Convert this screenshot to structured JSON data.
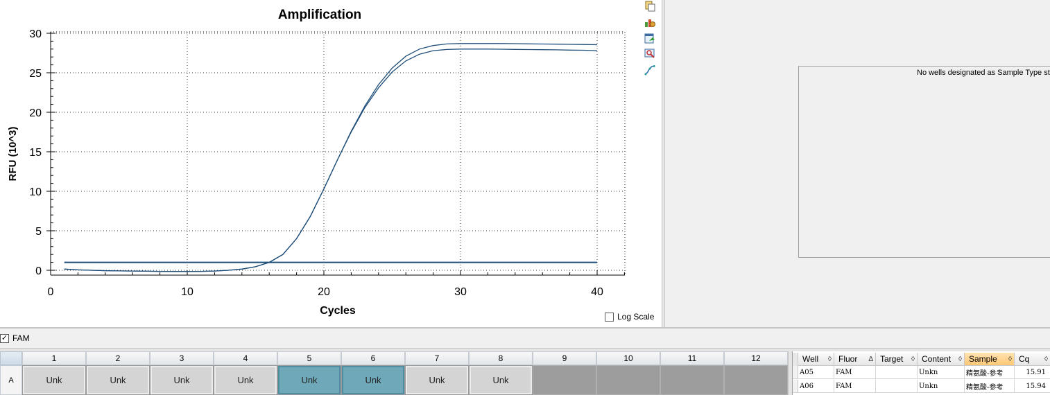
{
  "chart": {
    "title": "Amplification",
    "xlabel": "Cycles",
    "ylabel": "RFU (10^3)",
    "x_ticks": [
      "0",
      "10",
      "20",
      "30",
      "40"
    ],
    "y_ticks": [
      "0",
      "5",
      "10",
      "15",
      "20",
      "25",
      "30"
    ],
    "log_scale_label": "Log Scale",
    "line_color": "#1f4e79"
  },
  "chart_data": {
    "type": "line",
    "title": "Amplification",
    "xlabel": "Cycles",
    "ylabel": "RFU (10^3)",
    "xlim": [
      0,
      42
    ],
    "ylim": [
      -0.3,
      30.5
    ],
    "grid": true,
    "threshold": 1.0,
    "threshold_x_range": [
      1,
      40
    ],
    "series": [
      {
        "x": [
          1,
          2,
          3,
          4,
          5,
          6,
          7,
          8,
          9,
          10,
          11,
          12,
          13,
          14,
          15,
          16,
          17,
          18,
          19,
          20,
          21,
          22,
          23,
          24,
          25,
          26,
          27,
          28,
          29,
          30,
          31,
          32,
          33,
          34,
          35,
          36,
          37,
          38,
          39,
          40
        ],
        "values": [
          0.15,
          0.05,
          0.0,
          -0.05,
          -0.08,
          -0.1,
          -0.12,
          -0.14,
          -0.15,
          -0.15,
          -0.14,
          -0.1,
          0.0,
          0.15,
          0.45,
          1.0,
          2.0,
          4.0,
          6.8,
          10.3,
          14.0,
          17.6,
          20.8,
          23.5,
          25.6,
          27.1,
          28.0,
          28.45,
          28.65,
          28.7,
          28.7,
          28.7,
          28.7,
          28.68,
          28.66,
          28.64,
          28.62,
          28.6,
          28.58,
          28.55
        ]
      },
      {
        "x": [
          1,
          2,
          3,
          4,
          5,
          6,
          7,
          8,
          9,
          10,
          11,
          12,
          13,
          14,
          15,
          16,
          17,
          18,
          19,
          20,
          21,
          22,
          23,
          24,
          25,
          26,
          27,
          28,
          29,
          30,
          31,
          32,
          33,
          34,
          35,
          36,
          37,
          38,
          39,
          40
        ],
        "values": [
          0.15,
          0.05,
          0.0,
          -0.05,
          -0.08,
          -0.1,
          -0.12,
          -0.14,
          -0.15,
          -0.15,
          -0.14,
          -0.1,
          0.0,
          0.15,
          0.45,
          1.0,
          2.0,
          4.0,
          6.8,
          10.3,
          14.0,
          17.5,
          20.6,
          23.1,
          25.1,
          26.5,
          27.35,
          27.8,
          27.95,
          28.0,
          28.0,
          28.0,
          27.98,
          27.96,
          27.94,
          27.92,
          27.9,
          27.87,
          27.85,
          27.8
        ]
      }
    ]
  },
  "toolbar": {
    "icons": [
      "copy-icon",
      "chart-settings-icon",
      "export-icon",
      "zoom-icon",
      "curve-icon"
    ]
  },
  "standard_curve": {
    "message": "No wells designated as Sample Type star"
  },
  "fluor_filter": {
    "label": "FAM",
    "checked": true
  },
  "plate": {
    "columns": [
      "1",
      "2",
      "3",
      "4",
      "5",
      "6",
      "7",
      "8",
      "9",
      "10",
      "11",
      "12"
    ],
    "row_label": "A",
    "wells": [
      {
        "label": "Unk",
        "state": "std"
      },
      {
        "label": "Unk",
        "state": "std"
      },
      {
        "label": "Unk",
        "state": "std"
      },
      {
        "label": "Unk",
        "state": "std"
      },
      {
        "label": "Unk",
        "state": "sel"
      },
      {
        "label": "Unk",
        "state": "sel"
      },
      {
        "label": "Unk",
        "state": "std"
      },
      {
        "label": "Unk",
        "state": "std"
      },
      {
        "label": "",
        "state": "empty"
      },
      {
        "label": "",
        "state": "empty"
      },
      {
        "label": "",
        "state": "empty"
      },
      {
        "label": "",
        "state": "empty"
      }
    ]
  },
  "results": {
    "headers": [
      {
        "label": "Well",
        "sort": "◊"
      },
      {
        "label": "Fluor",
        "sort": "Δ"
      },
      {
        "label": "Target",
        "sort": "◊"
      },
      {
        "label": "Content",
        "sort": "◊"
      },
      {
        "label": "Sample",
        "sort": "◊"
      },
      {
        "label": "Cq",
        "sort": "◊"
      }
    ],
    "rows": [
      {
        "well": "A05",
        "fluor": "FAM",
        "target": "",
        "content": "Unkn",
        "sample": "精氨酸-参考",
        "cq": "15.91"
      },
      {
        "well": "A06",
        "fluor": "FAM",
        "target": "",
        "content": "Unkn",
        "sample": "精氨酸-参考",
        "cq": "15.94"
      }
    ]
  }
}
